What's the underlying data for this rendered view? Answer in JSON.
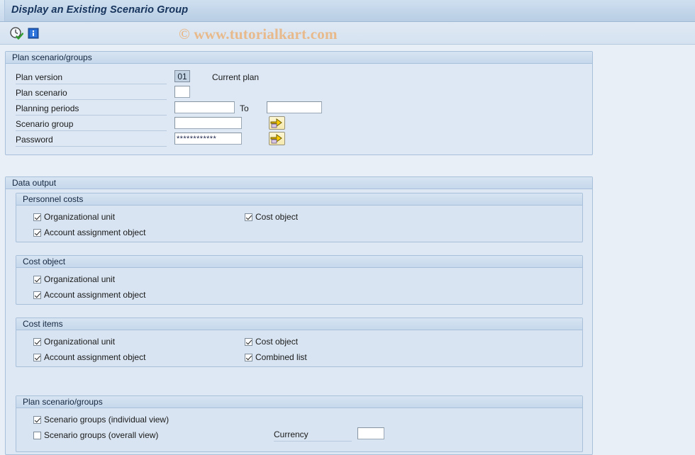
{
  "window": {
    "title": "Display an Existing Scenario Group"
  },
  "watermark": {
    "text": "© www.tutorialkart.com",
    "color": "#e8b98a"
  },
  "toolbar": {
    "buttons": [
      {
        "name": "execute-icon",
        "label": "Execute"
      },
      {
        "name": "info-icon",
        "label": "Information"
      }
    ]
  },
  "plan_scenario_groups": {
    "header": "Plan scenario/groups",
    "fields": {
      "plan_version": {
        "label": "Plan version",
        "value": "01",
        "description": "Current plan"
      },
      "plan_scenario": {
        "label": "Plan scenario",
        "value": ""
      },
      "planning_periods": {
        "label": "Planning periods",
        "value_from": "",
        "to_label": "To",
        "value_to": ""
      },
      "scenario_group": {
        "label": "Scenario group",
        "value": "",
        "button": "navigate-arrow"
      },
      "password": {
        "label": "Password",
        "value": "************",
        "button": "navigate-arrow"
      }
    }
  },
  "data_output": {
    "header": "Data output",
    "sections": [
      {
        "header": "Personnel costs",
        "left_items": [
          {
            "label": "Organizational unit",
            "checked": true
          },
          {
            "label": "Account assignment object",
            "checked": true
          }
        ],
        "right_items": [
          {
            "label": "Cost object",
            "checked": true
          }
        ]
      },
      {
        "header": "Cost object",
        "left_items": [
          {
            "label": "Organizational unit",
            "checked": true
          },
          {
            "label": "Account assignment object",
            "checked": true
          }
        ],
        "right_items": []
      },
      {
        "header": "Cost items",
        "left_items": [
          {
            "label": "Organizational unit",
            "checked": true
          },
          {
            "label": "Account assignment object",
            "checked": true
          }
        ],
        "right_items": [
          {
            "label": "Cost object",
            "checked": true
          },
          {
            "label": "Combined list",
            "checked": true
          }
        ]
      },
      {
        "header": "Plan scenario/groups",
        "left_items": [
          {
            "label": "Scenario groups (individual view)",
            "checked": true
          },
          {
            "label": "Scenario groups (overall view)",
            "checked": false
          }
        ],
        "right_items": [],
        "currency": {
          "label": "Currency",
          "value": ""
        }
      }
    ]
  }
}
